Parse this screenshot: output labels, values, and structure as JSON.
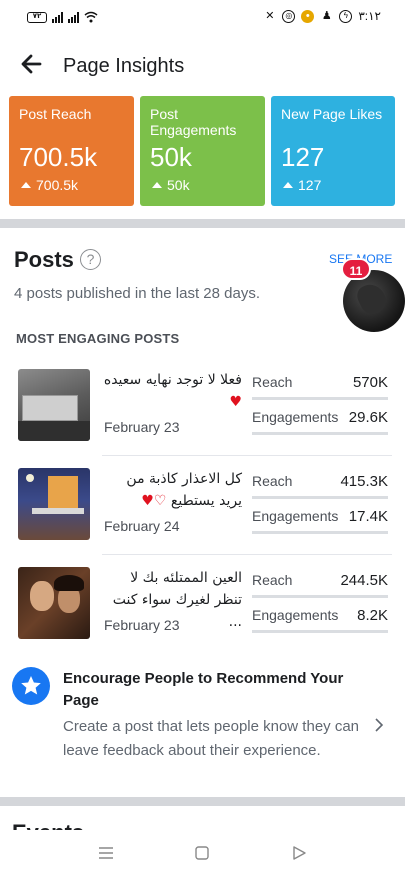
{
  "status_bar": {
    "battery": "٧٢",
    "time": "٣:١٢"
  },
  "header": {
    "title": "Page Insights"
  },
  "metrics": [
    {
      "label": "Post Reach",
      "value": "700.5k",
      "delta": "700.5k",
      "color": "#e8782f"
    },
    {
      "label": "Post Engagements",
      "value": "50k",
      "delta": "50k",
      "color": "#7cc04a"
    },
    {
      "label": "New Page Likes",
      "value": "127",
      "delta": "127",
      "color": "#2eb1e0"
    }
  ],
  "posts": {
    "title": "Posts",
    "help_icon": "?",
    "see_more": "SEE MORE",
    "subtitle": "4 posts published in the last 28 days.",
    "section_label": "MOST ENGAGING POSTS",
    "items": [
      {
        "text": "فعلا لا توجد نهايه سعيده",
        "emoji": "♥",
        "date": "February 23",
        "reach_label": "Reach",
        "reach": "570K",
        "engagements_label": "Engagements",
        "engagements": "29.6K"
      },
      {
        "text": "كل الاعذار كاذبة من يريد يستطيع",
        "emoji": "♡♥",
        "date": "February 24",
        "reach_label": "Reach",
        "reach": "415.3K",
        "engagements_label": "Engagements",
        "engagements": "17.4K"
      },
      {
        "text": "العين الممتلئه بك لا تنظر لغيرك سواء كنت ...",
        "emoji": "",
        "date": "February 23",
        "reach_label": "Reach",
        "reach": "244.5K",
        "engagements_label": "Engagements",
        "engagements": "8.2K"
      }
    ]
  },
  "recommend": {
    "title": "Encourage People to Recommend Your Page",
    "text": "Create a post that lets people know they can leave feedback about their experience."
  },
  "chat_head": {
    "badge": "11"
  },
  "next_section_title": "Events"
}
